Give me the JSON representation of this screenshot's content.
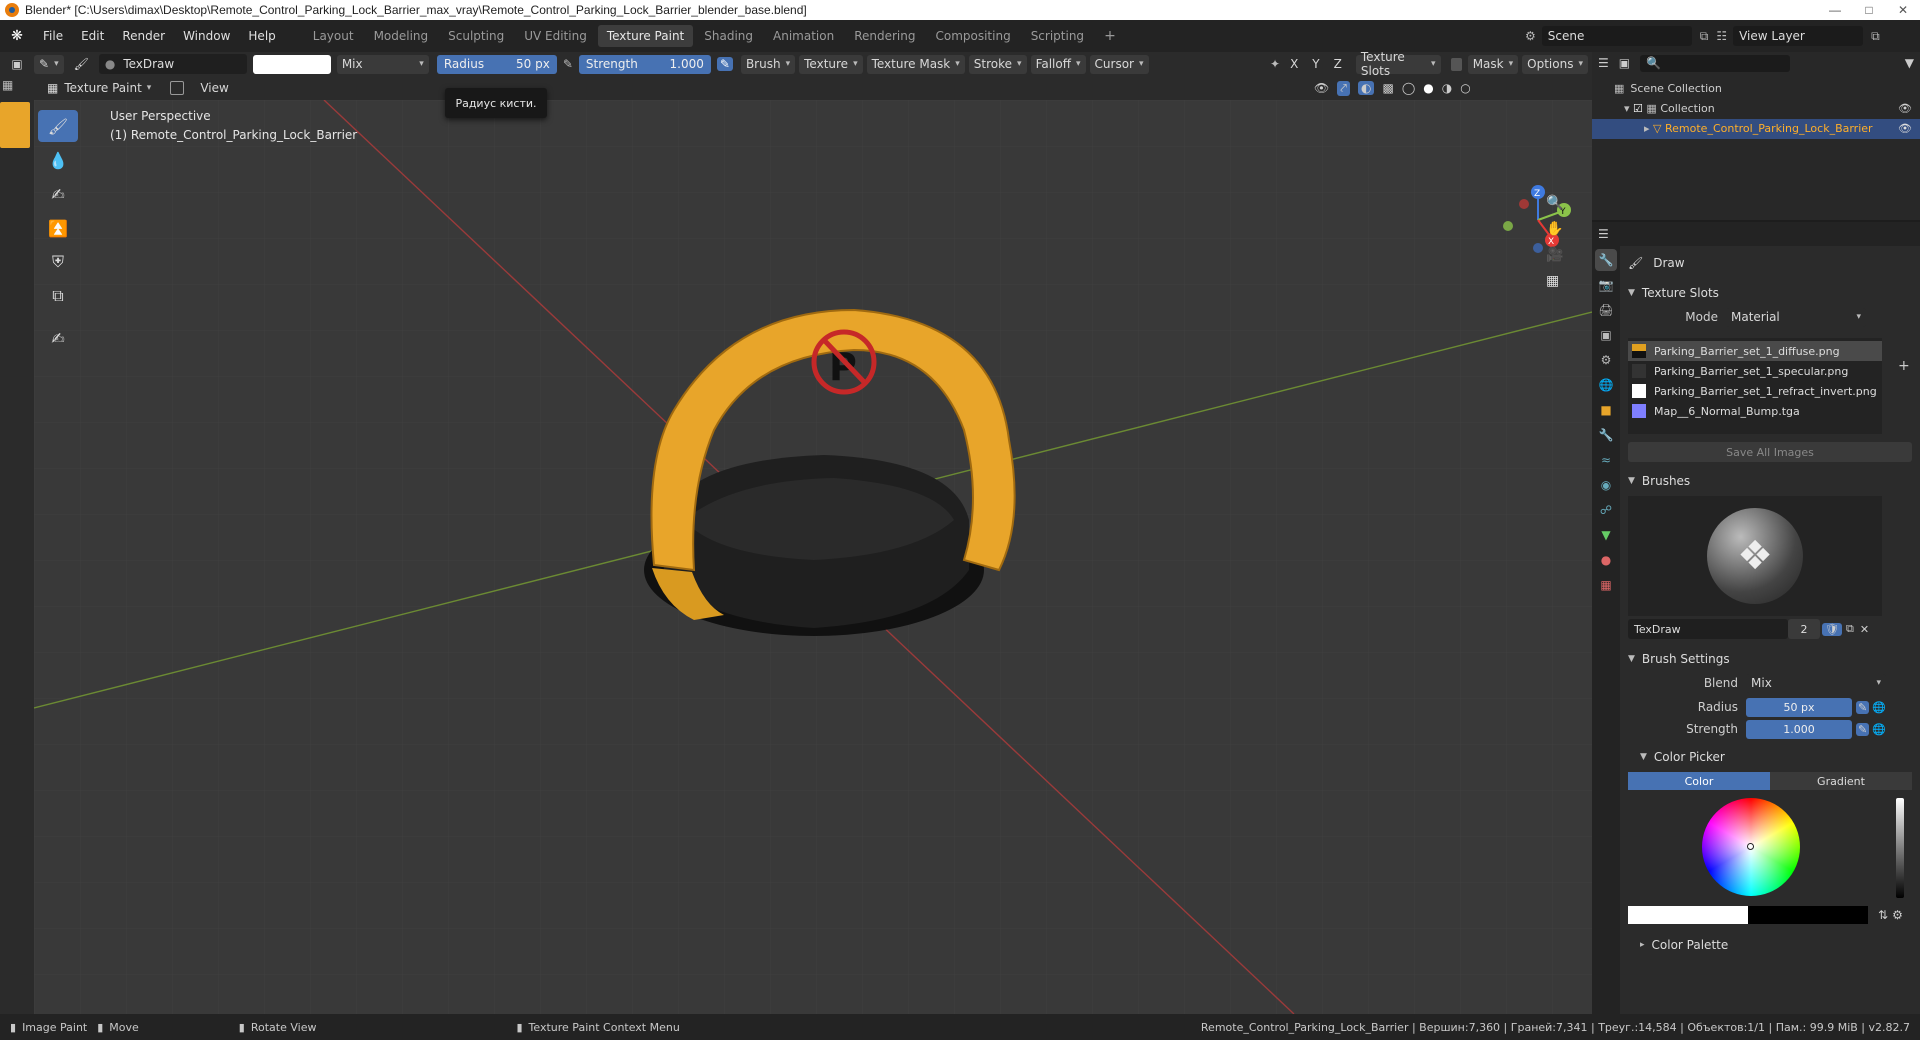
{
  "window": {
    "title": "Blender* [C:\\Users\\dimax\\Desktop\\Remote_Control_Parking_Lock_Barrier_max_vray\\Remote_Control_Parking_Lock_Barrier_blender_base.blend]"
  },
  "menu": [
    "File",
    "Edit",
    "Render",
    "Window",
    "Help"
  ],
  "workspaces": [
    "Layout",
    "Modeling",
    "Sculpting",
    "UV Editing",
    "Texture Paint",
    "Shading",
    "Animation",
    "Rendering",
    "Compositing",
    "Scripting"
  ],
  "active_workspace": "Texture Paint",
  "scene": {
    "name": "Scene",
    "view_layer": "View Layer"
  },
  "tool_header": {
    "brush_name": "TexDraw",
    "blend": "Mix",
    "radius_label": "Radius",
    "radius_value": "50 px",
    "strength_label": "Strength",
    "strength_value": "1.000",
    "menus": [
      "Brush",
      "Texture",
      "Texture Mask",
      "Stroke",
      "Falloff",
      "Cursor"
    ],
    "axes": [
      "X",
      "Y",
      "Z"
    ],
    "texture_slots_label": "Texture Slots",
    "mask_label": "Mask",
    "options_label": "Options"
  },
  "viewport_header": {
    "mode": "Texture Paint",
    "view_menu": "View"
  },
  "viewport": {
    "perspective": "User Perspective",
    "object_label": "(1) Remote_Control_Parking_Lock_Barrier",
    "tooltip": "Радиус кисти.",
    "colors": {
      "arch": "#e8a52a",
      "base": "#1a1a1a",
      "sign": "#c62828"
    }
  },
  "outliner": {
    "root": "Scene Collection",
    "collection": "Collection",
    "object": "Remote_Control_Parking_Lock_Barrier"
  },
  "properties": {
    "tool_name": "Draw",
    "texture_slots": {
      "title": "Texture Slots",
      "mode_label": "Mode",
      "mode_value": "Material",
      "slots": [
        {
          "name": "Parking_Barrier_set_1_diffuse.png",
          "color": "#e0a020"
        },
        {
          "name": "Parking_Barrier_set_1_specular.png",
          "color": "#333333"
        },
        {
          "name": "Parking_Barrier_set_1_refract_invert.png",
          "color": "#ffffff"
        },
        {
          "name": "Map__6_Normal_Bump.tga",
          "color": "#7f7fff"
        }
      ],
      "save_all": "Save All Images"
    },
    "brushes": {
      "title": "Brushes",
      "name": "TexDraw",
      "users": "2"
    },
    "brush_settings": {
      "title": "Brush Settings",
      "blend_label": "Blend",
      "blend_value": "Mix",
      "radius_label": "Radius",
      "radius_value": "50 px",
      "strength_label": "Strength",
      "strength_value": "1.000",
      "color_picker_title": "Color Picker",
      "tab_color": "Color",
      "tab_gradient": "Gradient",
      "color_palette": "Color Palette"
    }
  },
  "statusbar": {
    "left": [
      {
        "icon": "mouse-left-icon",
        "label": "Image Paint"
      },
      {
        "icon": "mouse-drag-icon",
        "label": "Move"
      },
      {
        "icon": "mouse-middle-icon",
        "label": "Rotate View"
      },
      {
        "icon": "mouse-right-icon",
        "label": "Texture Paint Context Menu"
      }
    ],
    "info": "Remote_Control_Parking_Lock_Barrier | Вершин:7,360 | Граней:7,341 | Треуг.:14,584 | Объектов:1/1 | Пам.: 99.9 MiB | v2.82.7"
  }
}
